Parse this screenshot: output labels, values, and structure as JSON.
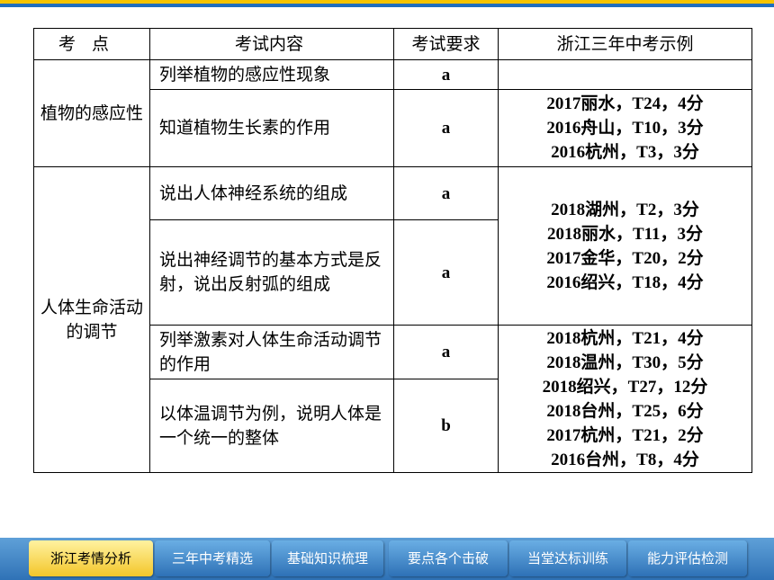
{
  "header": [
    "考点",
    "考试内容",
    "考试要求",
    "浙江三年中考示例"
  ],
  "groups": [
    {
      "topic": "植物的感应性",
      "rows": [
        {
          "content": "列举植物的感应性现象",
          "level": "a",
          "examples": []
        },
        {
          "content": "知道植物生长素的作用",
          "level": "a",
          "examples": [
            "2017丽水，T24，4分",
            "2016舟山，T10，3分",
            "2016杭州，T3，3分"
          ]
        }
      ]
    },
    {
      "topic": "人体生命活动的调节",
      "rows": [
        {
          "content": "说出人体神经系统的组成",
          "level": "a"
        },
        {
          "content": "说出神经调节的基本方式是反射，说出反射弧的组成",
          "level": "a"
        },
        {
          "content": "列举激素对人体生命活动调节的作用",
          "level": "a"
        },
        {
          "content": "以体温调节为例，说明人体是一个统一的整体",
          "level": "b"
        }
      ],
      "examples_nervous": [
        "2018湖州，T2，3分",
        "2018丽水，T11，3分",
        "2017金华，T20，2分",
        "2016绍兴，T18，4分"
      ],
      "examples_hormone": [
        "2018杭州，T21，4分",
        "2018温州，T30，5分",
        "2018绍兴，T27，12分",
        "2018台州，T25，6分",
        "2017杭州，T21，2分",
        "2016台州，T8，4分"
      ]
    }
  ],
  "nav": {
    "tabs": [
      "浙江考情分析",
      "三年中考精选",
      "基础知识梳理",
      "要点各个击破",
      "当堂达标训练",
      "能力评估检测"
    ],
    "active": "浙江考情分析"
  },
  "colors": {
    "accent_yellow": "#f3c62a",
    "accent_blue": "#2f72b6"
  }
}
